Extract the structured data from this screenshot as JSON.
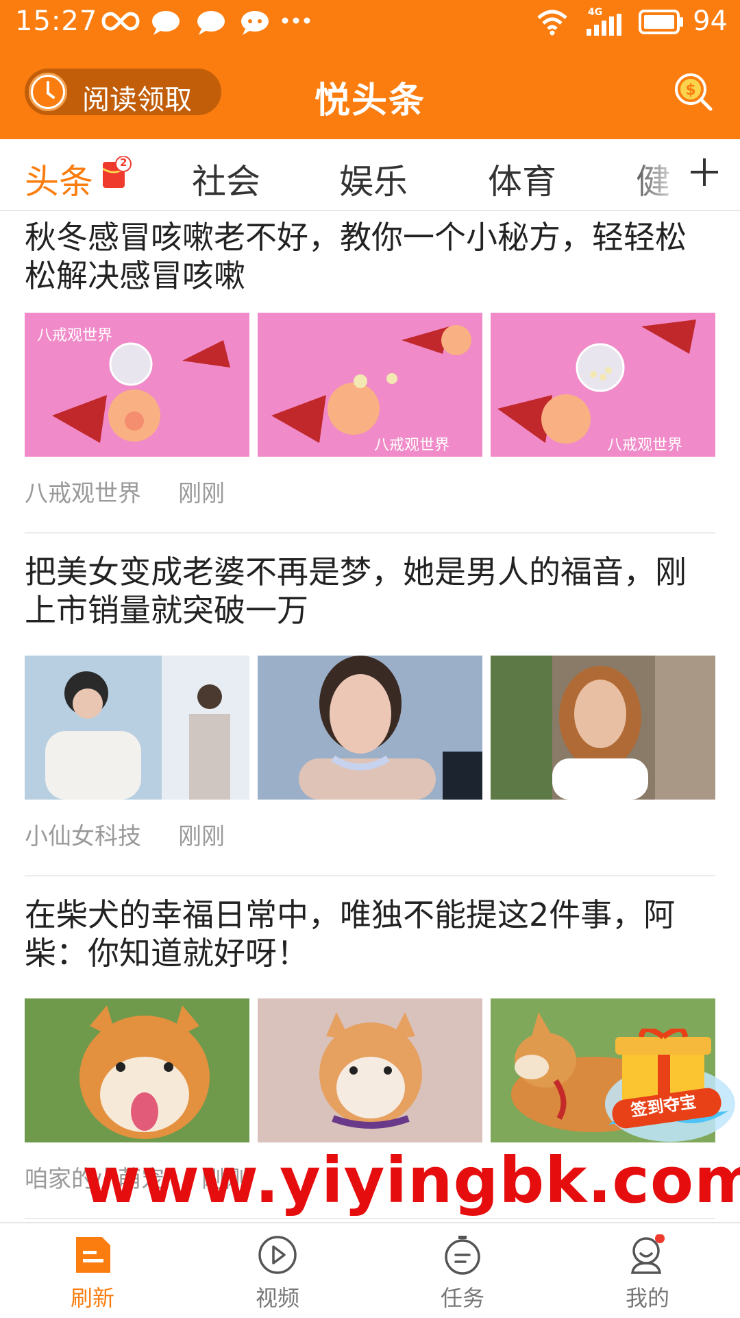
{
  "status_bar": {
    "time": "15:27",
    "network": "4G",
    "battery": "94"
  },
  "header": {
    "read_button": "阅读领取",
    "title": "悦头条",
    "coin_icon": "dollar-coin-search-icon"
  },
  "tabs": [
    {
      "label": "头条",
      "active": true,
      "badge": "2"
    },
    {
      "label": "社会"
    },
    {
      "label": "娱乐"
    },
    {
      "label": "体育"
    },
    {
      "label": "健"
    }
  ],
  "articles": [
    {
      "title": "秋冬感冒咳嗽老不好，教你一个小秘方，轻轻松松解决感冒咳嗽",
      "source": "八戒观世界",
      "time": "刚刚",
      "thumb_texts": [
        "八戒观世界",
        "八戒观世界",
        "八戒观世界"
      ]
    },
    {
      "title": "把美女变成老婆不再是梦，她是男人的福音，刚上市销量就突破一万",
      "source": "小仙女科技",
      "time": "刚刚"
    },
    {
      "title": "在柴犬的幸福日常中，唯独不能提这2件事，阿柴：你知道就好呀！",
      "source": "咱家的小萌宠",
      "time": "刚刚"
    }
  ],
  "promo": {
    "label": "签到夺宝"
  },
  "watermark": "www.yiyingbk.com",
  "bottom_nav": [
    {
      "label": "刷新",
      "active": true,
      "icon": "refresh-doc-icon"
    },
    {
      "label": "视频",
      "icon": "play-circle-icon"
    },
    {
      "label": "任务",
      "icon": "task-timer-icon"
    },
    {
      "label": "我的",
      "icon": "profile-icon",
      "dot": true
    }
  ],
  "colors": {
    "accent": "#fb7d0f",
    "watermark": "#e50d0d",
    "muted": "#9a9a9a"
  }
}
